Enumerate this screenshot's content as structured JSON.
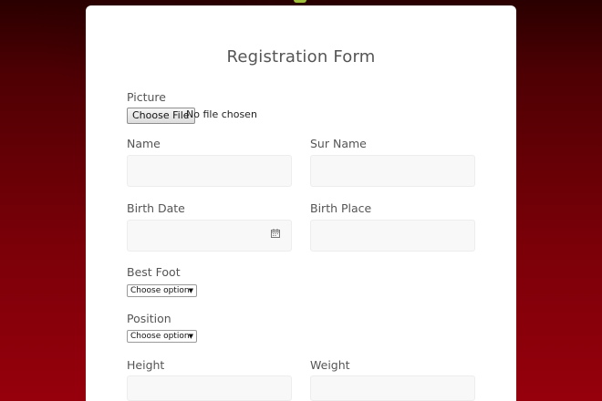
{
  "form": {
    "title": "Registration Form",
    "picture_label": "Picture",
    "file_button_label": "Choose File",
    "file_status": "No file chosen",
    "name_label": "Name",
    "surname_label": "Sur Name",
    "birth_date_label": "Birth Date",
    "birth_place_label": "Birth Place",
    "best_foot_label": "Best Foot",
    "best_foot_value": "Choose option",
    "position_label": "Position",
    "position_value": "Choose option",
    "height_label": "Height",
    "weight_label": "Weight"
  },
  "icons": {
    "calendar": "calendar-icon",
    "caret": "chevron-down-icon"
  },
  "colors": {
    "background": "#7a0008",
    "card": "#ffffff",
    "field": "#f8f8f8",
    "text": "#555555"
  }
}
